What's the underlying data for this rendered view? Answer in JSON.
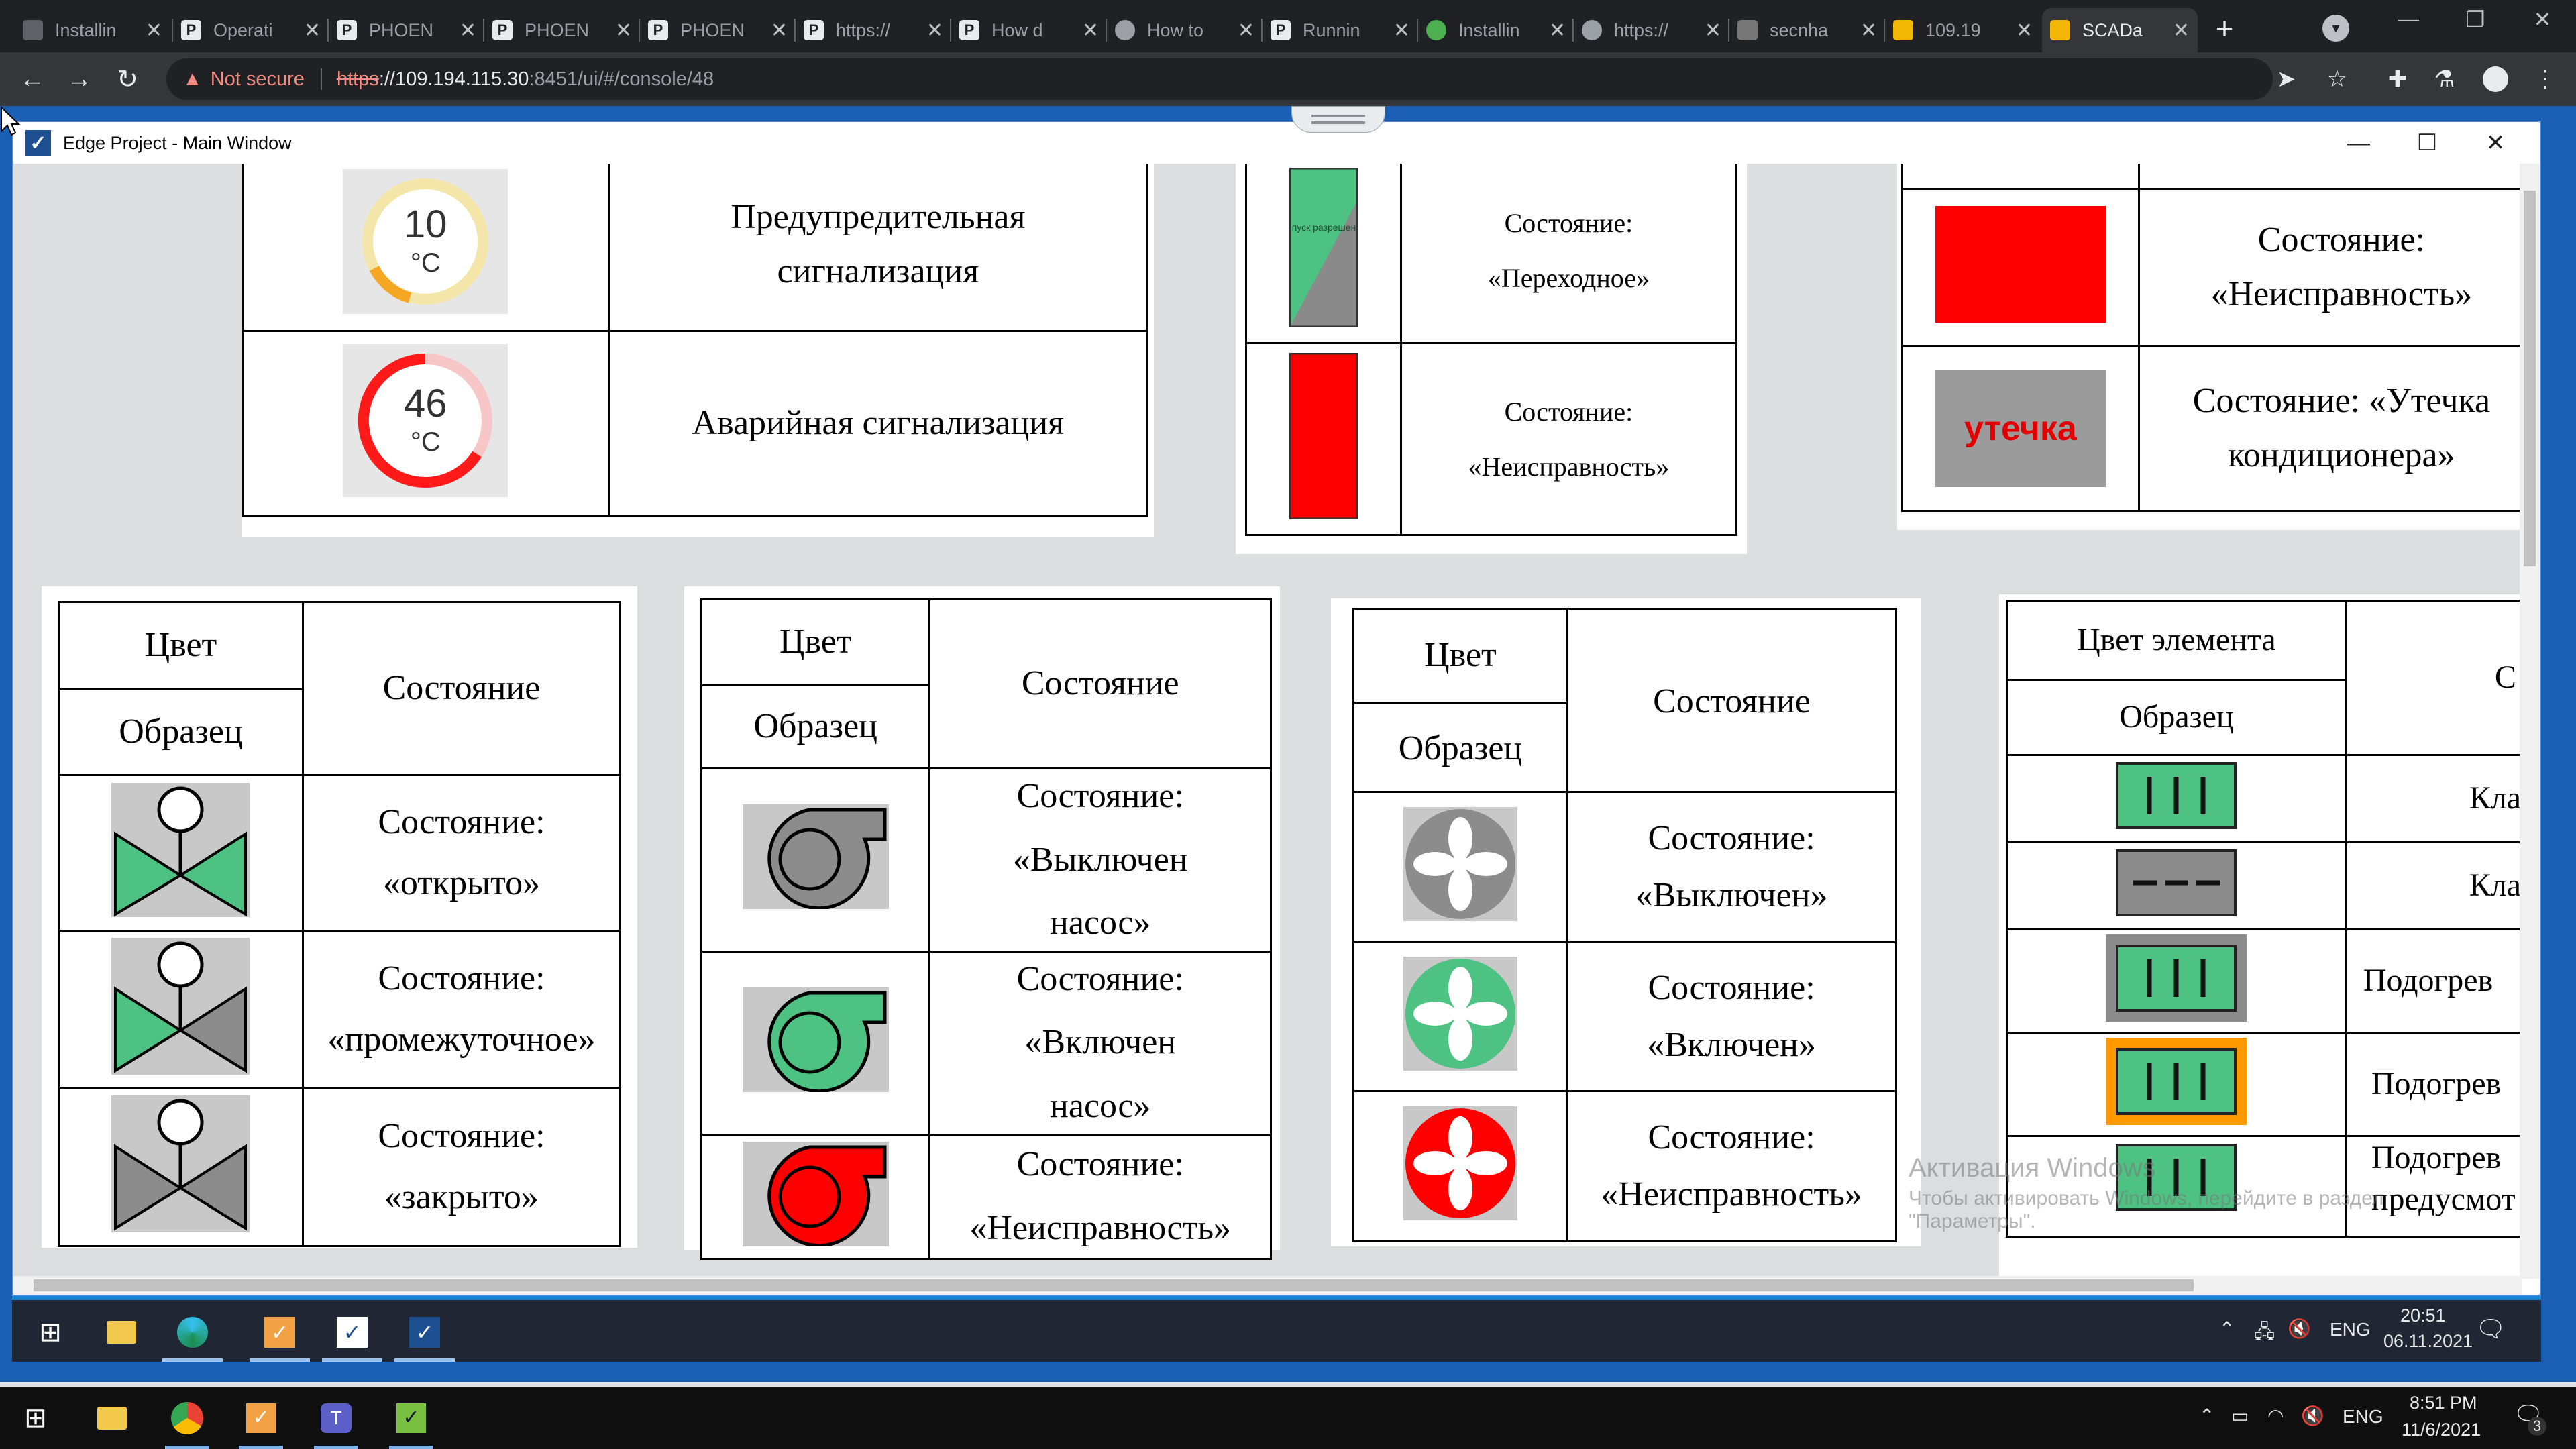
{
  "browser": {
    "tabs": [
      {
        "title": "Installin",
        "icon": "generic-tab-icon"
      },
      {
        "title": "Operati",
        "icon": "p-logo-icon"
      },
      {
        "title": "PHOEN",
        "icon": "p-logo-icon"
      },
      {
        "title": "PHOEN",
        "icon": "p-logo-icon"
      },
      {
        "title": "PHOEN",
        "icon": "p-logo-icon"
      },
      {
        "title": "https://",
        "icon": "p-logo-icon"
      },
      {
        "title": "How d",
        "icon": "p-logo-icon"
      },
      {
        "title": "How to",
        "icon": "globe-icon"
      },
      {
        "title": "Runnin",
        "icon": "p-logo-icon"
      },
      {
        "title": "Installin",
        "icon": "generic-tab-icon"
      },
      {
        "title": "https://",
        "icon": "globe-icon"
      },
      {
        "title": "secnha",
        "icon": "generic-tab-icon"
      },
      {
        "title": "109.19",
        "icon": "scada-icon"
      },
      {
        "title": "SCADa",
        "icon": "scada-icon",
        "active": true
      }
    ],
    "new_tab": "+",
    "not_secure": "Not secure",
    "url_proto": "https",
    "url_host": "://109.194.115.30",
    "url_path": ":8451/ui/#/console/48"
  },
  "window": {
    "title": "Edge Project - Main Window",
    "minimize": "—",
    "maximize": "☐",
    "close": "✕"
  },
  "top_tables": {
    "alarm": {
      "rows": [
        {
          "value": "10",
          "unit": "°C",
          "label": "Предупредительная сигнализация",
          "color": "#f5a623"
        },
        {
          "value": "46",
          "unit": "°C",
          "label": "Аварийная сигнализация",
          "color": "#ff1a1a"
        }
      ]
    },
    "damper": {
      "mini_label": "пуск разрешен",
      "rows": [
        {
          "label_top": "Состояние:",
          "label_bottom": "«Переходное»"
        },
        {
          "label_top": "Состояние:",
          "label_bottom": "«Неисправность»"
        }
      ]
    },
    "fault": {
      "rows": [
        {
          "label": "Состояние: «Неисправность»"
        },
        {
          "sample_text": "утечка",
          "label": "Состояние: «Утечка кондиционера»"
        }
      ]
    }
  },
  "valve_table": {
    "h_color": "Цвет",
    "h_sample": "Образец",
    "h_state": "Состояние",
    "rows": [
      {
        "line1": "Состояние:",
        "line2": "«открыто»"
      },
      {
        "line1": "Состояние:",
        "line2": "«промежуточное»"
      },
      {
        "line1": "Состояние:",
        "line2": "«закрыто»"
      }
    ]
  },
  "pump_table": {
    "h_color": "Цвет",
    "h_sample": "Образец",
    "h_state": "Состояние",
    "rows": [
      {
        "line1": "Состояние:",
        "line2": "«Выключен",
        "line3": "насос»",
        "color": "#8c8c8c"
      },
      {
        "line1": "Состояние:",
        "line2": "«Включен",
        "line3": "насос»",
        "color": "#4ec283"
      },
      {
        "line1": "Состояние:",
        "line2": "«Неисправность»",
        "line3": "",
        "color": "#ff0000"
      }
    ]
  },
  "fan_table": {
    "h_color": "Цвет",
    "h_sample": "Образец",
    "h_state": "Состояние",
    "rows": [
      {
        "line1": "Состояние:",
        "line2": "«Выключен»",
        "color": "#8c8c8c"
      },
      {
        "line1": "Состояние:",
        "line2": "«Включен»",
        "color": "#4ec283"
      },
      {
        "line1": "Состояние:",
        "line2": "«Неисправность»",
        "color": "#ff0000"
      }
    ]
  },
  "heater_table": {
    "h_color": "Цвет элемента",
    "h_sample": "Образец",
    "h_state_fragment": "С",
    "rows": [
      {
        "label": "Кла",
        "style": "green"
      },
      {
        "label": "Кла",
        "style": "grey"
      },
      {
        "label": "Подогрев",
        "style": "green-grey"
      },
      {
        "label": "Подогрев",
        "style": "green-orange"
      },
      {
        "label": "Подогрев",
        "label2": "предусмот",
        "style": "green"
      }
    ]
  },
  "watermark": {
    "line1": "Активация Windows",
    "line2": "Чтобы активировать Windows, перейдите в раздел",
    "line3": "\"Параметры\"."
  },
  "inner_taskbar": {
    "lang": "ENG",
    "time": "20:51",
    "date": "06.11.2021"
  },
  "host_taskbar": {
    "lang": "ENG",
    "time": "8:51 PM",
    "date": "11/6/2021",
    "notif_count": "3"
  }
}
